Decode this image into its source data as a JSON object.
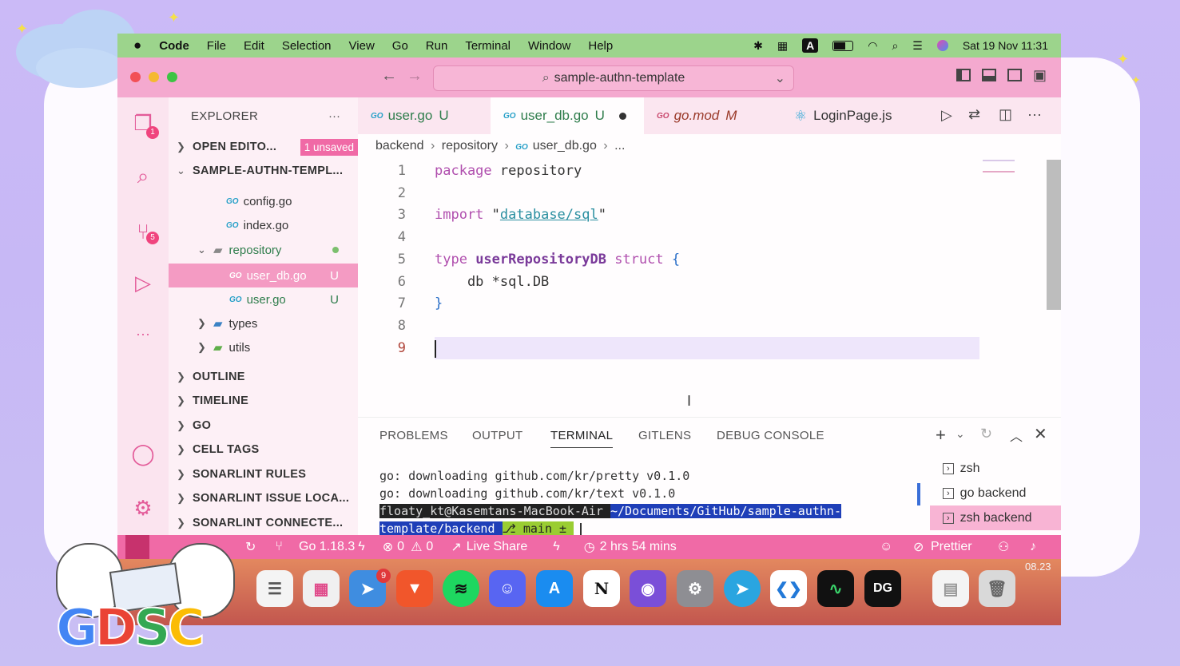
{
  "menubar": {
    "app": "Code",
    "items": [
      "File",
      "Edit",
      "Selection",
      "View",
      "Go",
      "Run",
      "Terminal",
      "Window",
      "Help"
    ],
    "clock": "Sat 19 Nov  11:31",
    "input_source": "A"
  },
  "titlebar": {
    "search": "sample-authn-template"
  },
  "activity": {
    "explorer_badge": "1",
    "scm_badge": "5",
    "more": "···"
  },
  "sidebar": {
    "title": "EXPLORER",
    "more": "···",
    "open_editors": "OPEN EDITO...",
    "unsaved": "1 unsaved",
    "project": "SAMPLE-AUTHN-TEMPL...",
    "files": [
      {
        "name": "config.go",
        "status": ""
      },
      {
        "name": "index.go",
        "status": ""
      },
      {
        "name": "repository",
        "status": ""
      },
      {
        "name": "user_db.go",
        "status": "U"
      },
      {
        "name": "user.go",
        "status": "U"
      },
      {
        "name": "types",
        "status": ""
      },
      {
        "name": "utils",
        "status": ""
      }
    ],
    "sections": [
      "OUTLINE",
      "TIMELINE",
      "GO",
      "CELL TAGS",
      "SONARLINT RULES",
      "SONARLINT ISSUE LOCA...",
      "SONARLINT CONNECTE..."
    ]
  },
  "tabs": [
    {
      "label": "user.go",
      "status": "U"
    },
    {
      "label": "user_db.go",
      "status": "U"
    },
    {
      "label": "go.mod",
      "status": "M"
    },
    {
      "label": "LoginPage.js",
      "status": ""
    }
  ],
  "breadcrumb": {
    "a": "backend",
    "b": "repository",
    "c": "user_db.go",
    "d": "..."
  },
  "code": {
    "ln": [
      "1",
      "2",
      "3",
      "4",
      "5",
      "6",
      "7",
      "8",
      "9"
    ],
    "l1_kw": "package",
    "l1_rest": " repository",
    "l3_kw": "import",
    "l3_q1": " \"",
    "l3_str": "database/sql",
    "l3_q2": "\"",
    "l5_kw": "type",
    "l5_name": " userRepositoryDB",
    "l5_kw2": " struct",
    "l5_brace": " {",
    "l6": "    db *sql.DB",
    "l7": "}"
  },
  "panel": {
    "tabs": [
      "PROBLEMS",
      "OUTPUT",
      "TERMINAL",
      "GITLENS",
      "DEBUG CONSOLE"
    ],
    "lines": [
      "go: downloading github.com/kr/pretty v0.1.0",
      "go: downloading github.com/kr/text v0.1.0"
    ],
    "prompt_user": " floaty_kt@Kasemtans-MacBook-Air ",
    "prompt_path": " ~/Documents/GitHub/sample-authn-",
    "prompt_path2": "template/backend ",
    "prompt_branch": " ⎇ main ± ",
    "terminals": [
      "zsh",
      "go  backend",
      "zsh  backend"
    ]
  },
  "statusbar": {
    "go": "Go 1.18.3",
    "errors": "0",
    "warnings": "0",
    "liveshare": "Live Share",
    "time": "2 hrs 54 mins",
    "prettier": "Prettier"
  },
  "dock": {
    "appstore_badge": "9",
    "dg": "DG",
    "notion": "N",
    "time": "08.23"
  },
  "colors": {
    "accent": "#f06aa6",
    "titlebar": "#f4a9cf",
    "menubar": "#9cd48c",
    "sidebar": "#fdf0f6"
  }
}
